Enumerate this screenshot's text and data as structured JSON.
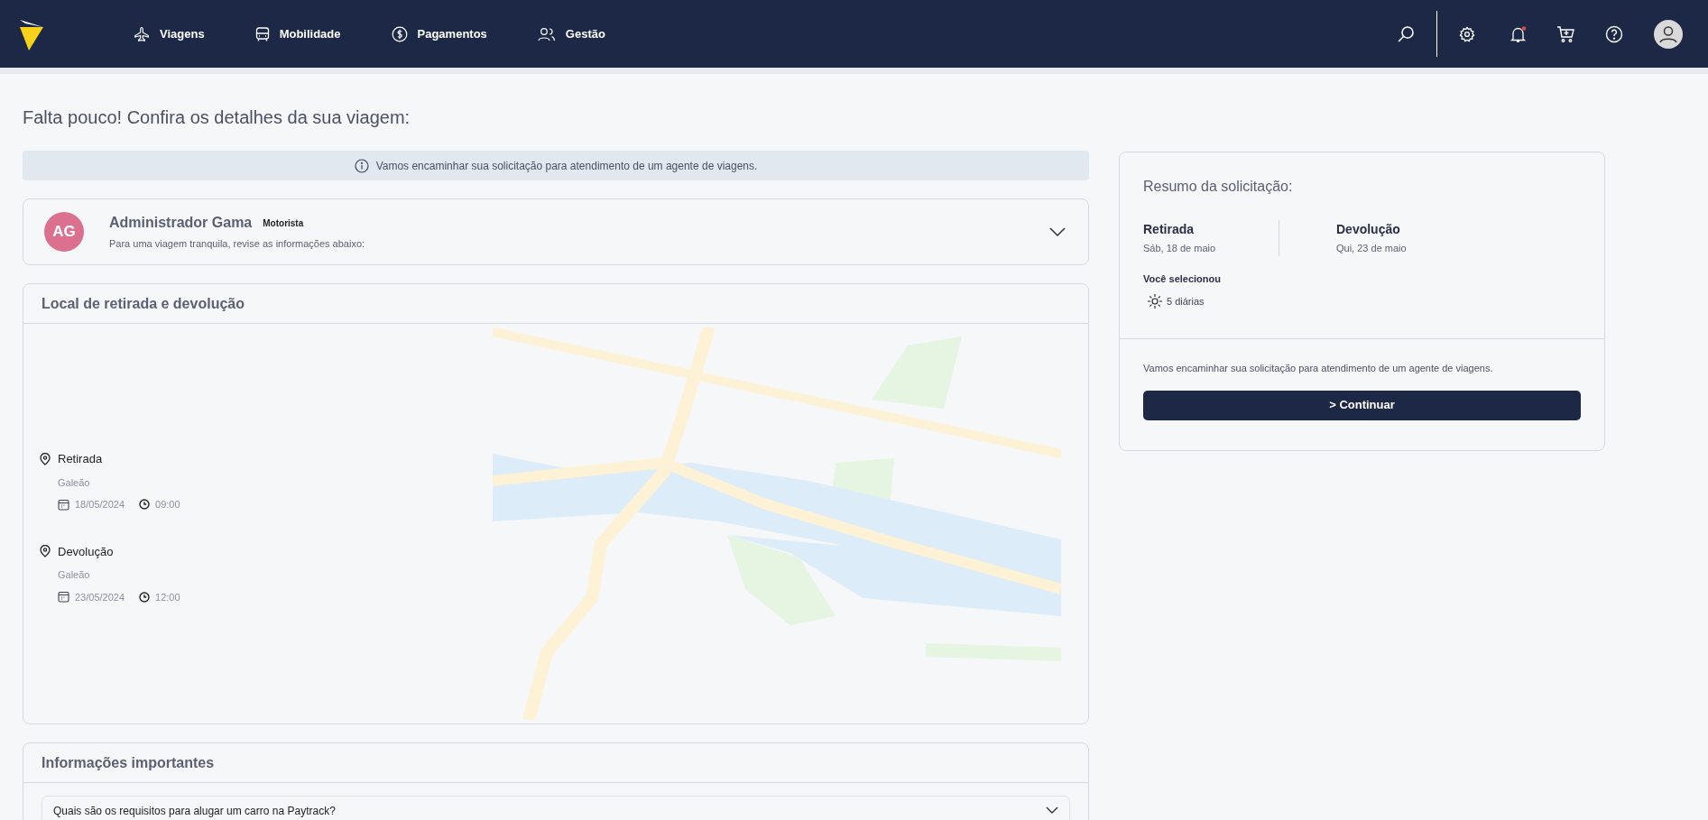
{
  "nav": {
    "items": [
      {
        "label": "Viagens"
      },
      {
        "label": "Mobilidade"
      },
      {
        "label": "Pagamentos"
      },
      {
        "label": "Gestão"
      }
    ],
    "bell_unread": true
  },
  "page_title": "Falta pouco! Confira os detalhes da sua viagem:",
  "banner": "Vamos encaminhar sua solicitação para atendimento de um agente de viagens.",
  "driver": {
    "initials": "AG",
    "name": "Administrador Gama",
    "role": "Motorista",
    "subtitle": "Para uma viagem tranquila, revise as informações abaixo:",
    "expanded": false
  },
  "locations": {
    "title": "Local de retirada e devolução",
    "stops": [
      {
        "label": "Retirada",
        "place": "Galeão",
        "date": "18/05/2024",
        "time": "09:00"
      },
      {
        "label": "Devolução",
        "place": "Galeão",
        "date": "23/05/2024",
        "time": "12:00"
      }
    ]
  },
  "info": {
    "title": "Informações importantes",
    "questions": [
      {
        "text": "Quais são os requisitos para alugar um carro na Paytrack?",
        "expanded": false
      }
    ]
  },
  "summary": {
    "title": "Resumo da solicitação:",
    "pickup": {
      "label": "Retirada",
      "date": "Sáb, 18 de maio"
    },
    "return": {
      "label": "Devolução",
      "date": "Qui, 23 de maio"
    },
    "selected_label": "Você selecionou",
    "dailies": "5 diárias",
    "note": "Vamos encaminhar sua solicitação para atendimento de um agente de viagens.",
    "button": "> Continuar"
  }
}
